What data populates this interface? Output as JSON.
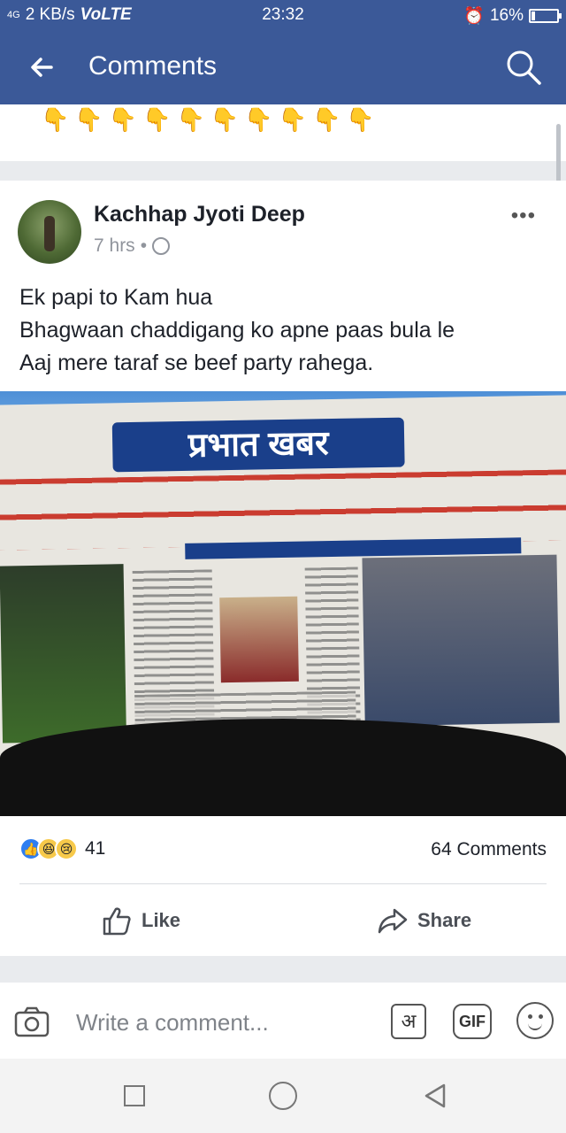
{
  "status_bar": {
    "signal": "4G",
    "network_speed": "2 KB/s",
    "network_type": "VoLTE",
    "time": "23:32",
    "battery_percent": "16%",
    "battery_level": 0.16
  },
  "app_bar": {
    "title": "Comments",
    "back_icon": "arrow-left-icon",
    "search_icon": "search-icon"
  },
  "previous_comment": {
    "emojis": "👇👇👇👇👇👇👇👇👇👇"
  },
  "post": {
    "author": "Kachhap Jyoti Deep",
    "time": "7 hrs",
    "separator": "•",
    "privacy_icon": "globe-icon",
    "more_icon": "more-options-icon",
    "more_label": "•••",
    "text_lines": [
      "Ek papi to Kam hua",
      "Bhagwaan chaddigang ko apne paas bula le",
      "Aaj mere taraf se beef party rahega."
    ],
    "image": {
      "masthead": "प्रभात खबर",
      "description_icon": "newspaper-photo"
    },
    "reactions": {
      "icons": [
        "like-reaction-icon",
        "haha-reaction-icon",
        "sad-reaction-icon"
      ],
      "count": "41"
    },
    "comments_count": "64 Comments",
    "actions": {
      "like": "Like",
      "share": "Share"
    }
  },
  "composer": {
    "placeholder": "Write a comment...",
    "hindi_label": "अ",
    "gif_label": "GIF"
  },
  "colors": {
    "brand": "#3b5998",
    "like_blue": "#2e7ef0",
    "text": "#1d2129",
    "muted": "#90949c"
  }
}
